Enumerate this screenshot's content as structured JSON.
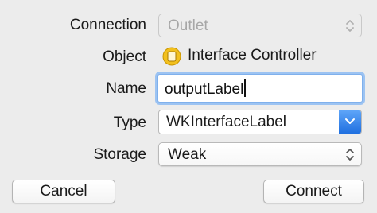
{
  "labels": {
    "connection": "Connection",
    "object": "Object",
    "name": "Name",
    "type": "Type",
    "storage": "Storage"
  },
  "connection": {
    "value": "Outlet",
    "enabled": false
  },
  "object": {
    "value": "Interface Controller",
    "icon": "interface-controller-icon",
    "icon_color": "#f2c01e"
  },
  "name_field": {
    "value": "outputLabel",
    "focused": true
  },
  "type_field": {
    "value": "WKInterfaceLabel"
  },
  "storage": {
    "value": "Weak"
  },
  "buttons": {
    "cancel": "Cancel",
    "connect": "Connect"
  },
  "colors": {
    "focus_ring": "#9cc3f2",
    "accent": "#1f6fe0"
  }
}
